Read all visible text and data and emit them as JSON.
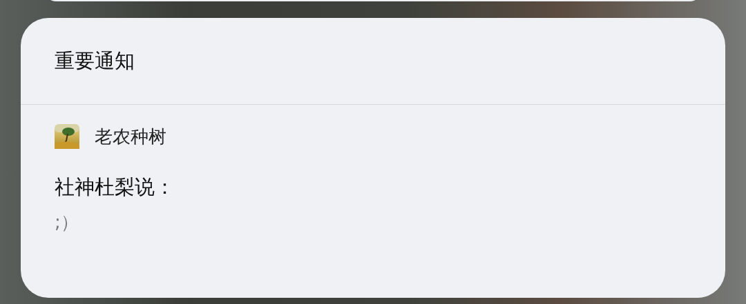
{
  "card": {
    "title": "重要通知"
  },
  "notification": {
    "app_name": "老农种树",
    "sender": "社神杜梨说：",
    "message": ";）"
  }
}
